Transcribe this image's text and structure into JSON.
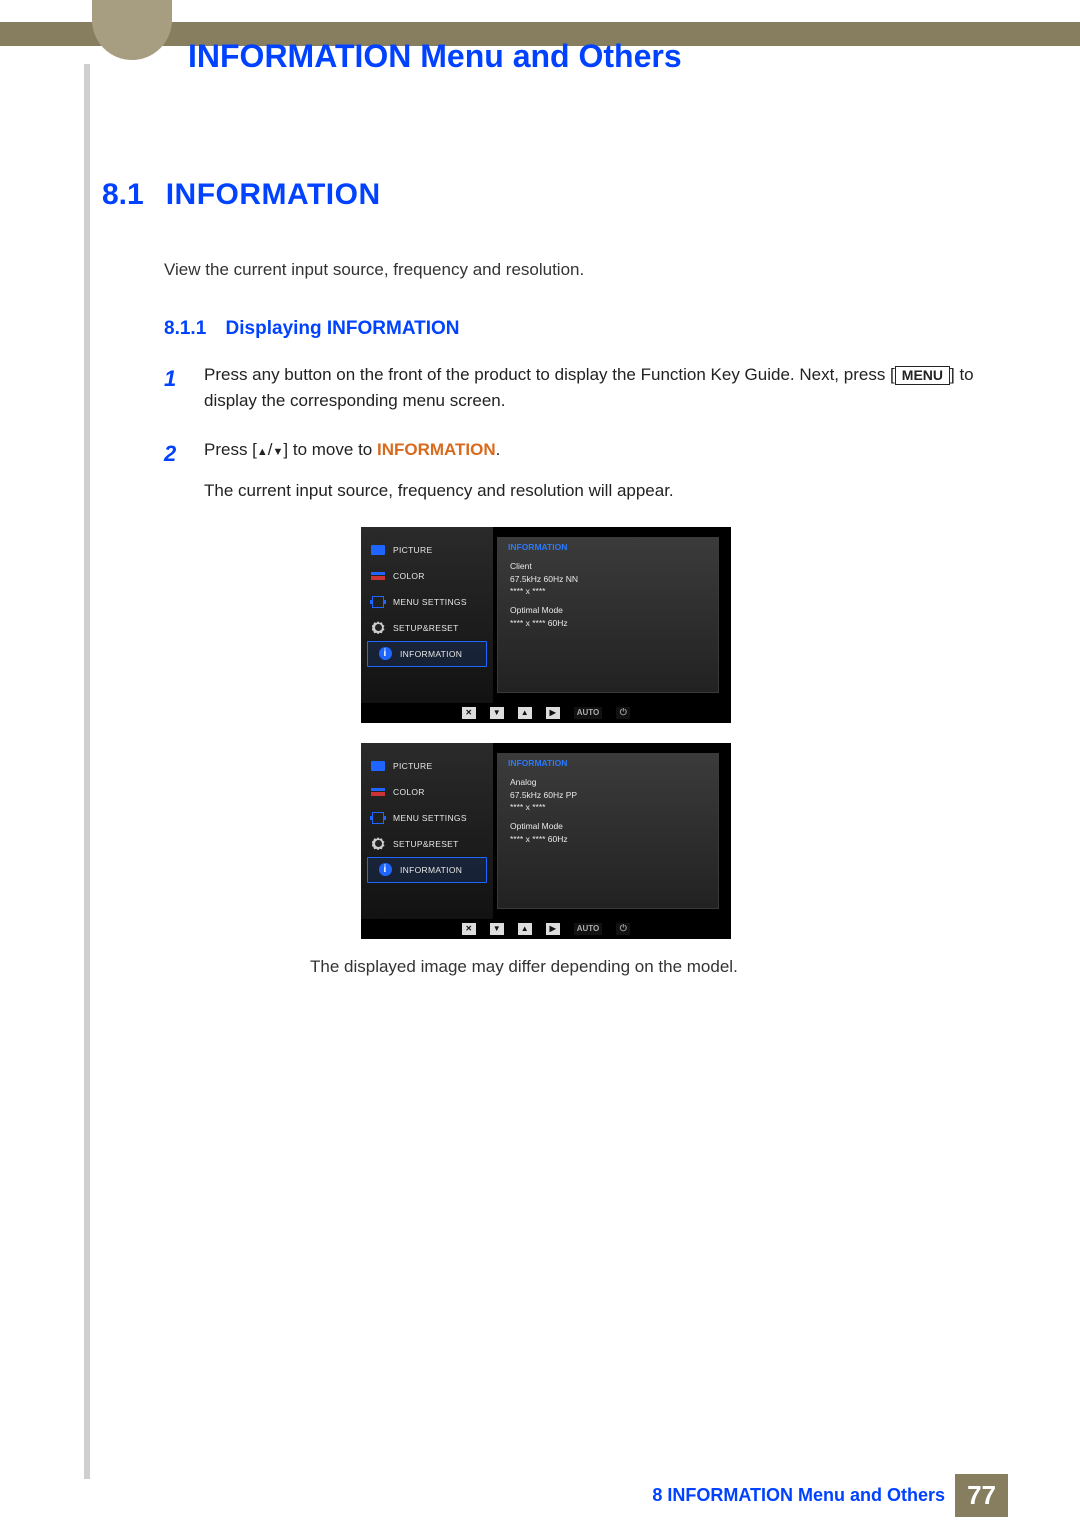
{
  "header": {
    "chapter_title": "INFORMATION Menu and Others"
  },
  "section": {
    "number": "8.1",
    "title": "INFORMATION",
    "intro": "View the current input source, frequency and resolution."
  },
  "subsection": {
    "number": "8.1.1",
    "title": "Displaying INFORMATION"
  },
  "steps": {
    "s1_num": "1",
    "s1_pre": "Press any button on the front of the product to display the Function Key Guide. Next, press [",
    "s1_key": "MENU",
    "s1_post": "] to display the corresponding menu screen.",
    "s2_num": "2",
    "s2_pre": "Press [",
    "s2_sep": "/",
    "s2_post": "] to move to ",
    "s2_target": "INFORMATION",
    "s2_end": ".",
    "s2_sub": "The current input source, frequency and resolution will appear."
  },
  "osd": {
    "menu": {
      "picture": "PICTURE",
      "color": "COLOR",
      "menu_settings": "MENU SETTINGS",
      "setup_reset": "SETUP&RESET",
      "information": "INFORMATION"
    },
    "panel_title": "INFORMATION",
    "screen1": {
      "line1": "Client",
      "line2": "67.5kHz 60Hz NN",
      "line3": "**** x ****",
      "line4": "Optimal Mode",
      "line5": "**** x **** 60Hz"
    },
    "screen2": {
      "line1": "Analog",
      "line2": "67.5kHz 60Hz PP",
      "line3": "**** x ****",
      "line4": "Optimal Mode",
      "line5": "**** x **** 60Hz"
    },
    "buttons": {
      "auto": "AUTO"
    }
  },
  "caption": "The displayed image may differ depending on the model.",
  "footer": {
    "text": "8 INFORMATION Menu and Others",
    "page": "77"
  }
}
